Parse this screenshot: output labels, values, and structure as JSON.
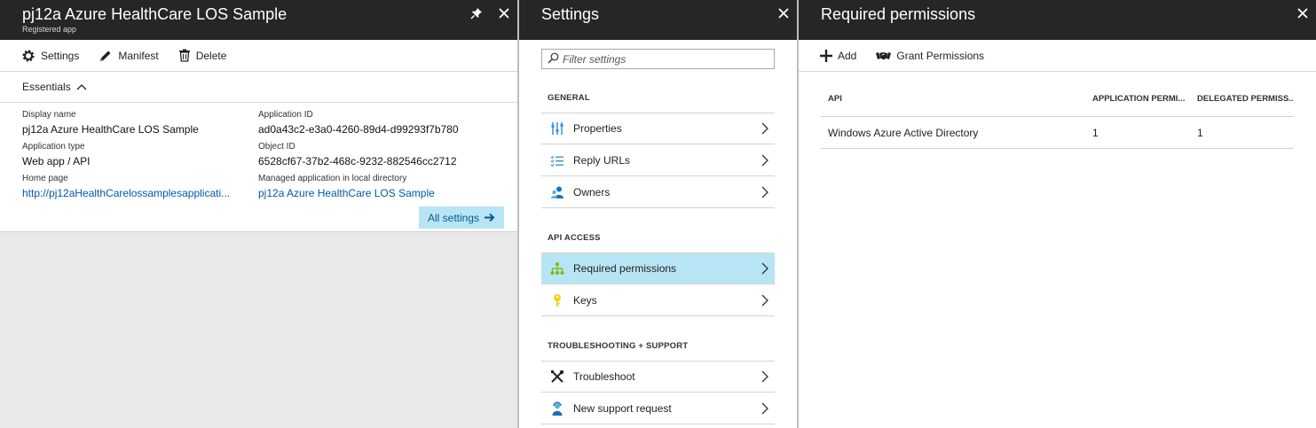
{
  "app_blade": {
    "title": "pj12a Azure HealthCare LOS Sample",
    "subtitle": "Registered app",
    "commands": {
      "settings": "Settings",
      "manifest": "Manifest",
      "delete": "Delete"
    },
    "essentials_label": "Essentials",
    "properties": {
      "display_name_label": "Display name",
      "display_name": "pj12a Azure HealthCare LOS Sample",
      "app_type_label": "Application type",
      "app_type": "Web app / API",
      "home_page_label": "Home page",
      "home_page": "http://pj12aHealthCarelossamplesapplicati...",
      "app_id_label": "Application ID",
      "app_id": "ad0a43c2-e3a0-4260-89d4-d99293f7b780",
      "object_id_label": "Object ID",
      "object_id": "6528cf67-37b2-468c-9232-882546cc2712",
      "managed_app_label": "Managed application in local directory",
      "managed_app": "pj12a Azure HealthCare LOS Sample"
    },
    "all_settings": "All settings"
  },
  "settings_blade": {
    "title": "Settings",
    "filter_placeholder": "Filter settings",
    "sections": {
      "general": "GENERAL",
      "api_access": "API ACCESS",
      "troubleshooting": "TROUBLESHOOTING + SUPPORT"
    },
    "items": {
      "properties": "Properties",
      "reply_urls": "Reply URLs",
      "owners": "Owners",
      "required_permissions": "Required permissions",
      "keys": "Keys",
      "troubleshoot": "Troubleshoot",
      "new_support_request": "New support request"
    },
    "selected_item": "Required permissions"
  },
  "permissions_blade": {
    "title": "Required permissions",
    "commands": {
      "add": "Add",
      "grant": "Grant Permissions"
    },
    "columns": [
      "API",
      "APPLICATION PERMI...",
      "DELEGATED PERMISS..."
    ],
    "rows": [
      {
        "api": "Windows Azure Active Directory",
        "application": "1",
        "delegated": "1"
      }
    ]
  },
  "colors": {
    "header_bg": "#262626",
    "selected_bg": "#b8e5f5",
    "link": "#0058ad"
  }
}
